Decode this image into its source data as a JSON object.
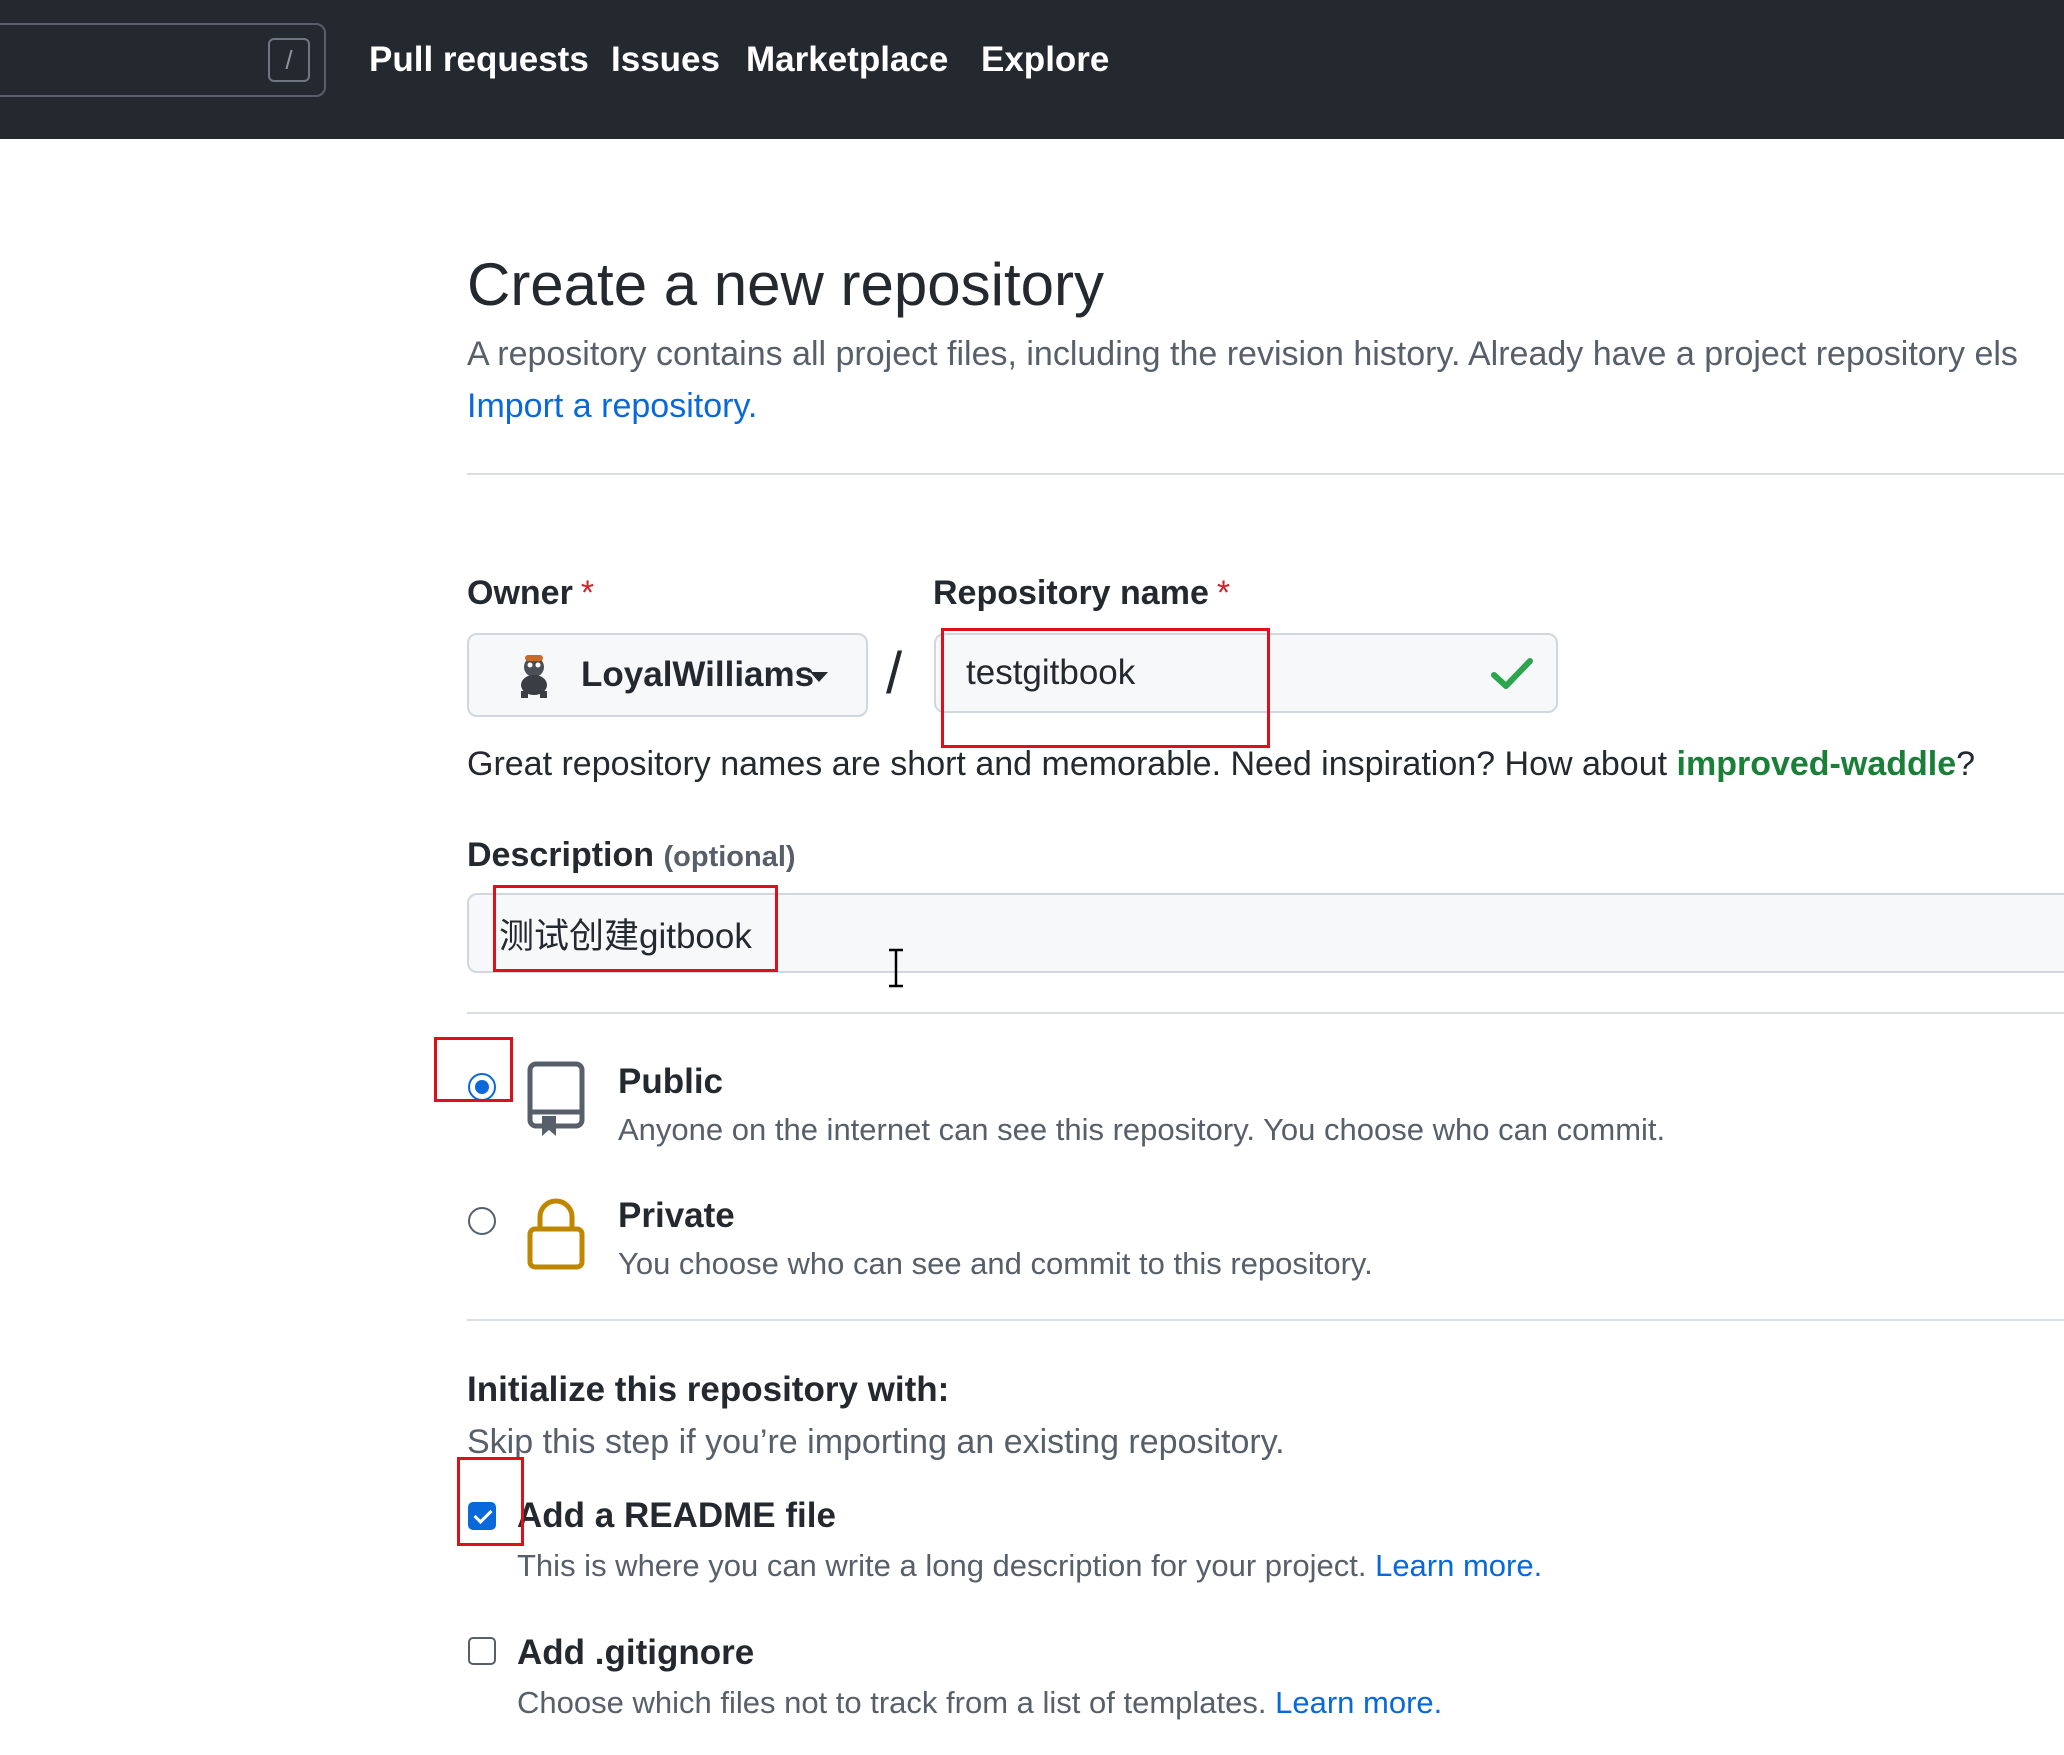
{
  "header": {
    "search_shortcut": "/",
    "nav": [
      "Pull requests",
      "Issues",
      "Marketplace",
      "Explore"
    ]
  },
  "page": {
    "title": "Create a new repository",
    "subtitle": "A repository contains all project files, including the revision history. Already have a project repository els",
    "import_link": "Import a repository."
  },
  "form": {
    "owner_label": "Owner",
    "required_mark": "*",
    "owner_value": "LoyalWilliams",
    "separator": "/",
    "repo_label": "Repository name",
    "repo_value": "testgitbook",
    "hint_text": "Great repository names are short and memorable. Need inspiration? How about ",
    "hint_suggestion": "improved-waddle",
    "hint_end": "?",
    "desc_label": "Description",
    "desc_optional": "(optional)",
    "desc_value": "测试创建gitbook"
  },
  "visibility": {
    "selected": "public",
    "public_title": "Public",
    "public_desc": "Anyone on the internet can see this repository. You choose who can commit.",
    "private_title": "Private",
    "private_desc": "You choose who can see and commit to this repository."
  },
  "init": {
    "title": "Initialize this repository with:",
    "subtitle": "Skip this step if you’re importing an existing repository.",
    "readme_label": "Add a README file",
    "readme_checked": true,
    "readme_desc": "This is where you can write a long description for your project.",
    "learn_more": "Learn more.",
    "gitignore_label": "Add .gitignore",
    "gitignore_checked": false,
    "gitignore_desc": "Choose which files not to track from a list of templates."
  },
  "colors": {
    "header_bg": "#24292f",
    "link": "#0969da",
    "success": "#1a7f37",
    "required": "#cf222e",
    "annotation": "#e0101b",
    "lock": "#bf8700"
  },
  "icons": [
    "search-shortcut-icon",
    "owner-avatar",
    "caret-down-icon",
    "check-icon",
    "repo-icon",
    "lock-icon",
    "text-cursor-icon"
  ]
}
